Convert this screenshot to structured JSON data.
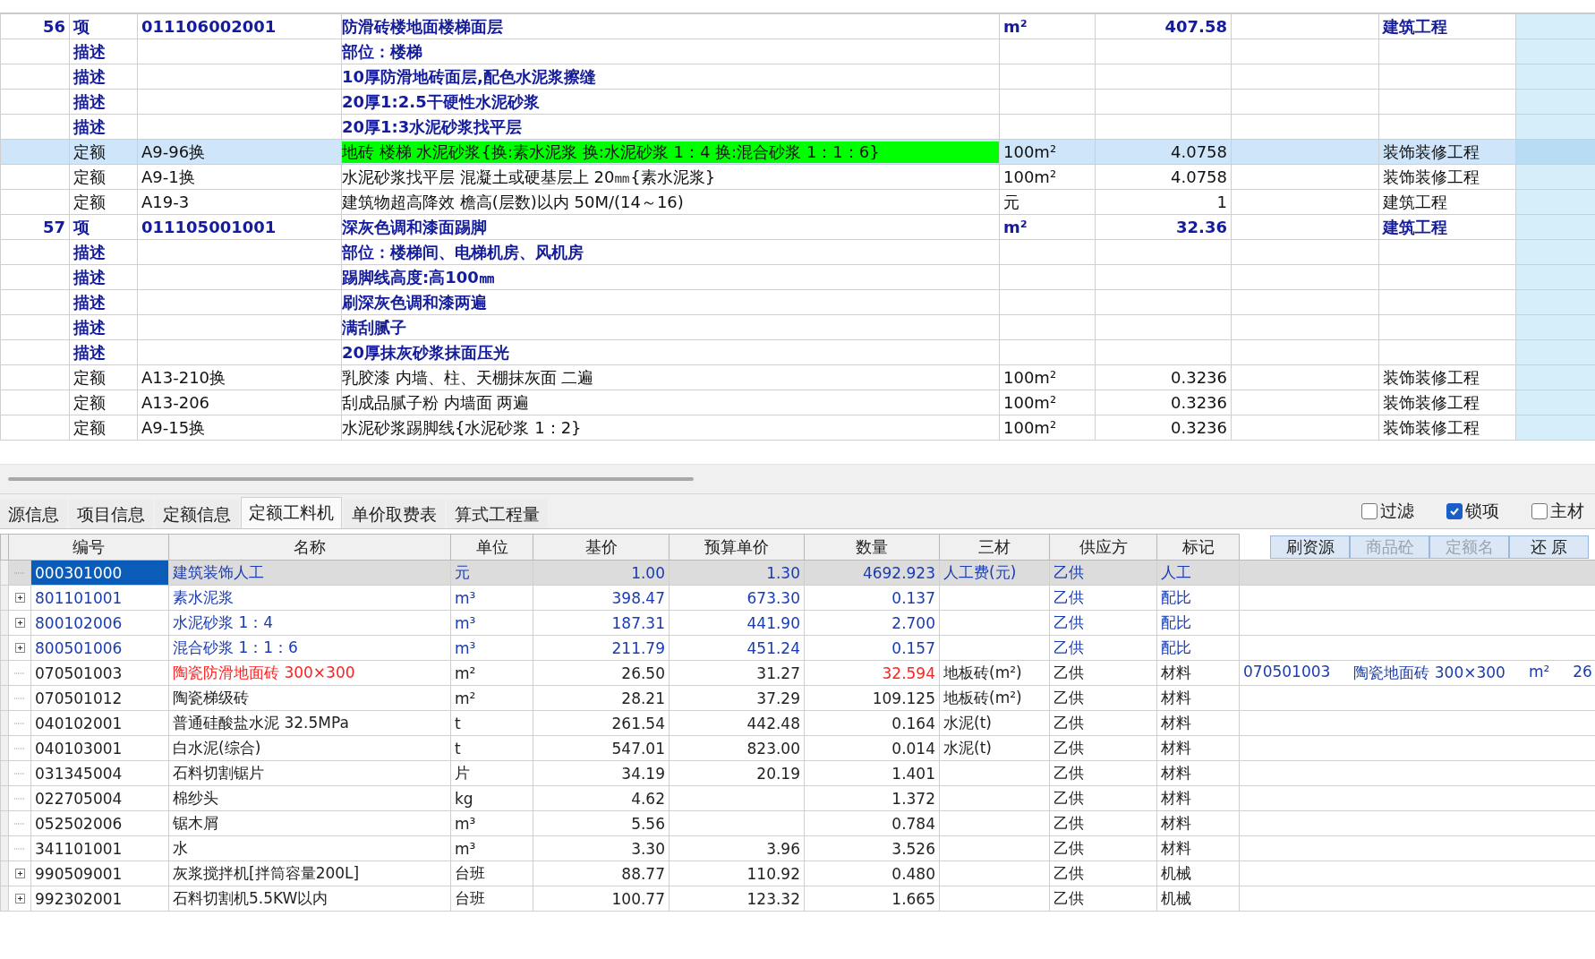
{
  "quota_table": {
    "rows": [
      {
        "no": "56",
        "type": "项",
        "code": "011106002001",
        "name": "防滑砖楼地面楼梯面层",
        "unit": "m²",
        "qty": "407.58",
        "category": "建筑工程",
        "kind": "item",
        "selected": false,
        "highlight": false
      },
      {
        "type": "描述",
        "name": "部位：楼梯",
        "kind": "desc",
        "selected": false,
        "highlight": false
      },
      {
        "type": "描述",
        "name": "10厚防滑地砖面层,配色水泥浆擦缝",
        "kind": "desc",
        "selected": false,
        "highlight": false
      },
      {
        "type": "描述",
        "name": "20厚1:2.5干硬性水泥砂浆",
        "kind": "desc",
        "selected": false,
        "highlight": false
      },
      {
        "type": "描述",
        "name": "20厚1:3水泥砂浆找平层",
        "kind": "desc",
        "selected": false,
        "highlight": false
      },
      {
        "type": "定额",
        "code": "A9-96换",
        "name": "地砖 楼梯 水泥砂浆{换:素水泥浆 换:水泥砂浆 1：4 换:混合砂浆 1：1：6}",
        "unit": "100m²",
        "qty": "4.0758",
        "category": "装饰装修工程",
        "kind": "quota",
        "selected": true,
        "highlight": true
      },
      {
        "type": "定额",
        "code": "A9-1换",
        "name": "水泥砂浆找平层 混凝土或硬基层上 20㎜{素水泥浆}",
        "unit": "100m²",
        "qty": "4.0758",
        "category": "装饰装修工程",
        "kind": "quota",
        "selected": false,
        "highlight": false
      },
      {
        "type": "定额",
        "code": "A19-3",
        "name": "建筑物超高降效 檐高(层数)以内 50M/(14～16)",
        "unit": "元",
        "qty": "1",
        "category": "建筑工程",
        "kind": "quota",
        "selected": false,
        "highlight": false
      },
      {
        "no": "57",
        "type": "项",
        "code": "011105001001",
        "name": "深灰色调和漆面踢脚",
        "unit": "m²",
        "qty": "32.36",
        "category": "建筑工程",
        "kind": "item",
        "selected": false,
        "highlight": false
      },
      {
        "type": "描述",
        "name": "部位：楼梯间、电梯机房、风机房",
        "kind": "desc",
        "selected": false,
        "highlight": false
      },
      {
        "type": "描述",
        "name": "踢脚线高度:高100㎜",
        "kind": "desc",
        "selected": false,
        "highlight": false
      },
      {
        "type": "描述",
        "name": "刷深灰色调和漆两遍",
        "kind": "desc",
        "selected": false,
        "highlight": false
      },
      {
        "type": "描述",
        "name": "满刮腻子",
        "kind": "desc",
        "selected": false,
        "highlight": false
      },
      {
        "type": "描述",
        "name": "20厚抹灰砂浆抹面压光",
        "kind": "desc",
        "selected": false,
        "highlight": false
      },
      {
        "type": "定额",
        "code": "A13-210换",
        "name": "乳胶漆 内墙、柱、天棚抹灰面 二遍",
        "unit": "100m²",
        "qty": "0.3236",
        "category": "装饰装修工程",
        "kind": "quota",
        "selected": false,
        "highlight": false
      },
      {
        "type": "定额",
        "code": "A13-206",
        "name": "刮成品腻子粉 内墙面 两遍",
        "unit": "100m²",
        "qty": "0.3236",
        "category": "装饰装修工程",
        "kind": "quota",
        "selected": false,
        "highlight": false
      },
      {
        "type": "定额",
        "code": "A9-15换",
        "name": "水泥砂浆踢脚线{水泥砂浆 1：2}",
        "unit": "100m²",
        "qty": "0.3236",
        "category": "装饰装修工程",
        "kind": "quota",
        "selected": false,
        "highlight": false
      }
    ]
  },
  "tabs": [
    {
      "label": "源信息",
      "selected": false
    },
    {
      "label": "项目信息",
      "selected": false
    },
    {
      "label": "定额信息",
      "selected": false
    },
    {
      "label": "定额工料机",
      "selected": true
    },
    {
      "label": "单价取费表",
      "selected": false
    },
    {
      "label": "算式工程量",
      "selected": false
    }
  ],
  "filters": [
    {
      "label": "过滤",
      "checked": false
    },
    {
      "label": "锁项",
      "checked": true
    },
    {
      "label": "主材",
      "checked": false
    }
  ],
  "resource_table": {
    "columns": [
      "编号",
      "名称",
      "单位",
      "基价",
      "预算单价",
      "数量",
      "三材",
      "供应方",
      "标记"
    ],
    "actions": [
      {
        "label": "刷资源",
        "disabled": false
      },
      {
        "label": "商品砼",
        "disabled": true
      },
      {
        "label": "定额名",
        "disabled": true
      },
      {
        "label": "还 原",
        "disabled": false
      }
    ],
    "rows": [
      {
        "code": "000301000",
        "name": "建筑装饰人工",
        "unit": "元",
        "base": "1.00",
        "price": "1.30",
        "qty": "4692.923",
        "material": "人工费(元)",
        "supplier": "乙供",
        "mark": "人工",
        "kind": "labor",
        "expandable": false,
        "selected": true,
        "substituted": false
      },
      {
        "code": "801101001",
        "name": "素水泥浆",
        "unit": "m³",
        "base": "398.47",
        "price": "673.30",
        "qty": "0.137",
        "supplier": "乙供",
        "mark": "配比",
        "kind": "mix",
        "expandable": true,
        "selected": false,
        "substituted": false
      },
      {
        "code": "800102006",
        "name": "水泥砂浆 1：4",
        "unit": "m³",
        "base": "187.31",
        "price": "441.90",
        "qty": "2.700",
        "supplier": "乙供",
        "mark": "配比",
        "kind": "mix",
        "expandable": true,
        "selected": false,
        "substituted": false
      },
      {
        "code": "800501006",
        "name": "混合砂浆 1：1：6",
        "unit": "m³",
        "base": "211.79",
        "price": "451.24",
        "qty": "0.157",
        "supplier": "乙供",
        "mark": "配比",
        "kind": "mix",
        "expandable": true,
        "selected": false,
        "substituted": false
      },
      {
        "code": "070501003",
        "name": "陶瓷防滑地面砖 300×300",
        "unit": "m²",
        "base": "26.50",
        "price": "31.27",
        "qty": "32.594",
        "material": "地板砖(m²)",
        "supplier": "乙供",
        "mark": "材料",
        "kind": "material",
        "expandable": false,
        "selected": false,
        "substituted": true,
        "replacement": {
          "code": "070501003",
          "name": "陶瓷地面砖 300×300",
          "unit": "m²",
          "value": "26"
        }
      },
      {
        "code": "070501012",
        "name": "陶瓷梯级砖",
        "unit": "m²",
        "base": "28.21",
        "price": "37.29",
        "qty": "109.125",
        "material": "地板砖(m²)",
        "supplier": "乙供",
        "mark": "材料",
        "kind": "material",
        "expandable": false,
        "selected": false,
        "substituted": false
      },
      {
        "code": "040102001",
        "name": "普通硅酸盐水泥 32.5MPa",
        "unit": "t",
        "base": "261.54",
        "price": "442.48",
        "qty": "0.164",
        "material": "水泥(t)",
        "supplier": "乙供",
        "mark": "材料",
        "kind": "material",
        "expandable": false,
        "selected": false,
        "substituted": false
      },
      {
        "code": "040103001",
        "name": "白水泥(综合)",
        "unit": "t",
        "base": "547.01",
        "price": "823.00",
        "qty": "0.014",
        "material": "水泥(t)",
        "supplier": "乙供",
        "mark": "材料",
        "kind": "material",
        "expandable": false,
        "selected": false,
        "substituted": false
      },
      {
        "code": "031345004",
        "name": "石料切割锯片",
        "unit": "片",
        "base": "34.19",
        "price": "20.19",
        "qty": "1.401",
        "supplier": "乙供",
        "mark": "材料",
        "kind": "material",
        "expandable": false,
        "selected": false,
        "substituted": false
      },
      {
        "code": "022705004",
        "name": "棉纱头",
        "unit": "kg",
        "base": "4.62",
        "qty": "1.372",
        "supplier": "乙供",
        "mark": "材料",
        "kind": "material",
        "expandable": false,
        "selected": false,
        "substituted": false
      },
      {
        "code": "052502006",
        "name": "锯木屑",
        "unit": "m³",
        "base": "5.56",
        "qty": "0.784",
        "supplier": "乙供",
        "mark": "材料",
        "kind": "material",
        "expandable": false,
        "selected": false,
        "substituted": false
      },
      {
        "code": "341101001",
        "name": "水",
        "unit": "m³",
        "base": "3.30",
        "price": "3.96",
        "qty": "3.526",
        "supplier": "乙供",
        "mark": "材料",
        "kind": "material",
        "expandable": false,
        "selected": false,
        "substituted": false
      },
      {
        "code": "990509001",
        "name": "灰浆搅拌机[拌筒容量200L]",
        "unit": "台班",
        "base": "88.77",
        "price": "110.92",
        "qty": "0.480",
        "supplier": "乙供",
        "mark": "机械",
        "kind": "machine",
        "expandable": true,
        "selected": false,
        "substituted": false
      },
      {
        "code": "992302001",
        "name": "石料切割机5.5KW以内",
        "unit": "台班",
        "base": "100.77",
        "price": "123.32",
        "qty": "1.665",
        "supplier": "乙供",
        "mark": "机械",
        "kind": "machine",
        "expandable": true,
        "selected": false,
        "substituted": false
      }
    ]
  }
}
